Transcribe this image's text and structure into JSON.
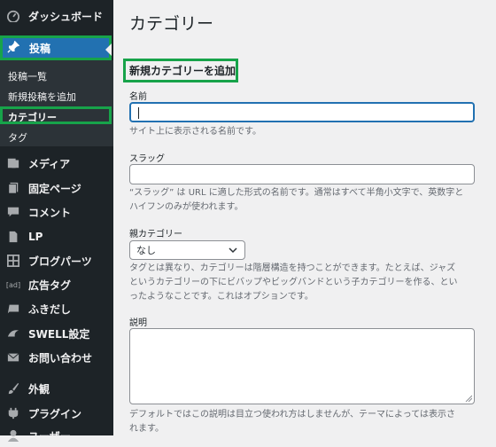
{
  "sidebar": {
    "top_items": [
      {
        "label": "ダッシュボード",
        "icon": "dashboard-icon"
      }
    ],
    "active": {
      "label": "投稿",
      "icon": "pin-icon"
    },
    "submenu": [
      "投稿一覧",
      "新規投稿を追加",
      "カテゴリー",
      "タグ"
    ],
    "submenu_current_index": 2,
    "items": [
      {
        "label": "メディア",
        "icon": "media-icon"
      },
      {
        "label": "固定ページ",
        "icon": "pages-icon"
      },
      {
        "label": "コメント",
        "icon": "comments-icon"
      },
      {
        "label": "LP",
        "icon": "document-icon"
      },
      {
        "label": "ブログパーツ",
        "icon": "grid-icon"
      },
      {
        "label": "広告タグ",
        "icon": "ad-icon"
      },
      {
        "label": "ふきだし",
        "icon": "speech-bubble-icon"
      },
      {
        "label": "SWELL設定",
        "icon": "swell-icon"
      },
      {
        "label": "お問い合わせ",
        "icon": "mail-icon"
      },
      {
        "label": "外観",
        "icon": "brush-icon"
      },
      {
        "label": "プラグイン",
        "icon": "plug-icon"
      },
      {
        "label": "ユーザー",
        "icon": "user-icon"
      }
    ]
  },
  "main": {
    "title": "カテゴリー",
    "section_heading": "新規カテゴリーを追加",
    "name_label": "名前",
    "name_value": "",
    "name_desc": "サイト上に表示される名前です。",
    "slug_label": "スラッグ",
    "slug_value": "",
    "slug_desc_line1": "“スラッグ” は URL に適した形式の名前です。通常はすべて半角小文字で、英数字と",
    "slug_desc_line2": "ハイフンのみが使われます。",
    "parent_label": "親カテゴリー",
    "parent_selected": "なし",
    "parent_desc_line1": "タグとは異なり、カテゴリーは階層構造を持つことができます。たとえば、ジャズ",
    "parent_desc_line2": "というカテゴリーの下にビバップやビッグバンドという子カテゴリーを作る、とい",
    "parent_desc_line3": "ったようなことです。これはオプションです。",
    "description_label": "説明",
    "description_value": "",
    "description_desc_line1": "デフォルトではこの説明は目立つ使われ方はしませんが、テーマによっては表示さ",
    "description_desc_line2": "れます。"
  },
  "colors": {
    "sidebar_bg": "#1d2327",
    "active_bg": "#2271b1",
    "highlight": "#17a34a"
  }
}
